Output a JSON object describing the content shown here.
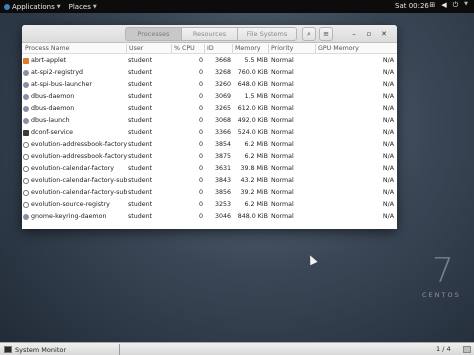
{
  "topbar": {
    "applications": "Applications",
    "places": "Places",
    "clock": "Sat 00:26"
  },
  "tabs": [
    "Processes",
    "Resources",
    "File Systems"
  ],
  "columns": {
    "name": "Process Name",
    "user": "User",
    "cpu": "% CPU",
    "id": "ID",
    "memory": "Memory",
    "priority": "Priority",
    "gpu": "GPU Memory"
  },
  "processes": [
    {
      "name": "abrt-applet",
      "user": "student",
      "cpu": "0",
      "id": "3668",
      "memory": "5.5 MiB",
      "priority": "Normal",
      "gpu": "N/A",
      "icon": "orange"
    },
    {
      "name": "at-spi2-registryd",
      "user": "student",
      "cpu": "0",
      "id": "3268",
      "memory": "760.0 KiB",
      "priority": "Normal",
      "gpu": "N/A",
      "icon": "gear"
    },
    {
      "name": "at-spi-bus-launcher",
      "user": "student",
      "cpu": "0",
      "id": "3260",
      "memory": "648.0 KiB",
      "priority": "Normal",
      "gpu": "N/A",
      "icon": "gear"
    },
    {
      "name": "dbus-daemon",
      "user": "student",
      "cpu": "0",
      "id": "3069",
      "memory": "1.5 MiB",
      "priority": "Normal",
      "gpu": "N/A",
      "icon": "gear"
    },
    {
      "name": "dbus-daemon",
      "user": "student",
      "cpu": "0",
      "id": "3265",
      "memory": "612.0 KiB",
      "priority": "Normal",
      "gpu": "N/A",
      "icon": "gear"
    },
    {
      "name": "dbus-launch",
      "user": "student",
      "cpu": "0",
      "id": "3068",
      "memory": "492.0 KiB",
      "priority": "Normal",
      "gpu": "N/A",
      "icon": "gear"
    },
    {
      "name": "dconf-service",
      "user": "student",
      "cpu": "0",
      "id": "3366",
      "memory": "524.0 KiB",
      "priority": "Normal",
      "gpu": "N/A",
      "icon": "dark"
    },
    {
      "name": "evolution-addressbook-factory",
      "user": "student",
      "cpu": "0",
      "id": "3854",
      "memory": "6.2 MiB",
      "priority": "Normal",
      "gpu": "N/A",
      "icon": "outline"
    },
    {
      "name": "evolution-addressbook-factory-",
      "user": "student",
      "cpu": "0",
      "id": "3875",
      "memory": "6.2 MiB",
      "priority": "Normal",
      "gpu": "N/A",
      "icon": "outline"
    },
    {
      "name": "evolution-calendar-factory",
      "user": "student",
      "cpu": "0",
      "id": "3631",
      "memory": "39.8 MiB",
      "priority": "Normal",
      "gpu": "N/A",
      "icon": "outline"
    },
    {
      "name": "evolution-calendar-factory-subp",
      "user": "student",
      "cpu": "0",
      "id": "3843",
      "memory": "43.2 MiB",
      "priority": "Normal",
      "gpu": "N/A",
      "icon": "outline"
    },
    {
      "name": "evolution-calendar-factory-subp",
      "user": "student",
      "cpu": "0",
      "id": "3856",
      "memory": "39.2 MiB",
      "priority": "Normal",
      "gpu": "N/A",
      "icon": "outline"
    },
    {
      "name": "evolution-source-registry",
      "user": "student",
      "cpu": "0",
      "id": "3253",
      "memory": "6.2 MiB",
      "priority": "Normal",
      "gpu": "N/A",
      "icon": "outline"
    },
    {
      "name": "gnome-keyring-daemon",
      "user": "student",
      "cpu": "0",
      "id": "3046",
      "memory": "848.0 KiB",
      "priority": "Normal",
      "gpu": "N/A",
      "icon": "gear"
    }
  ],
  "desktop": {
    "logo_number": "7",
    "logo_text": "CENTOS"
  },
  "taskbar": {
    "app_label": "System Monitor",
    "workspace": "1 / 4"
  }
}
